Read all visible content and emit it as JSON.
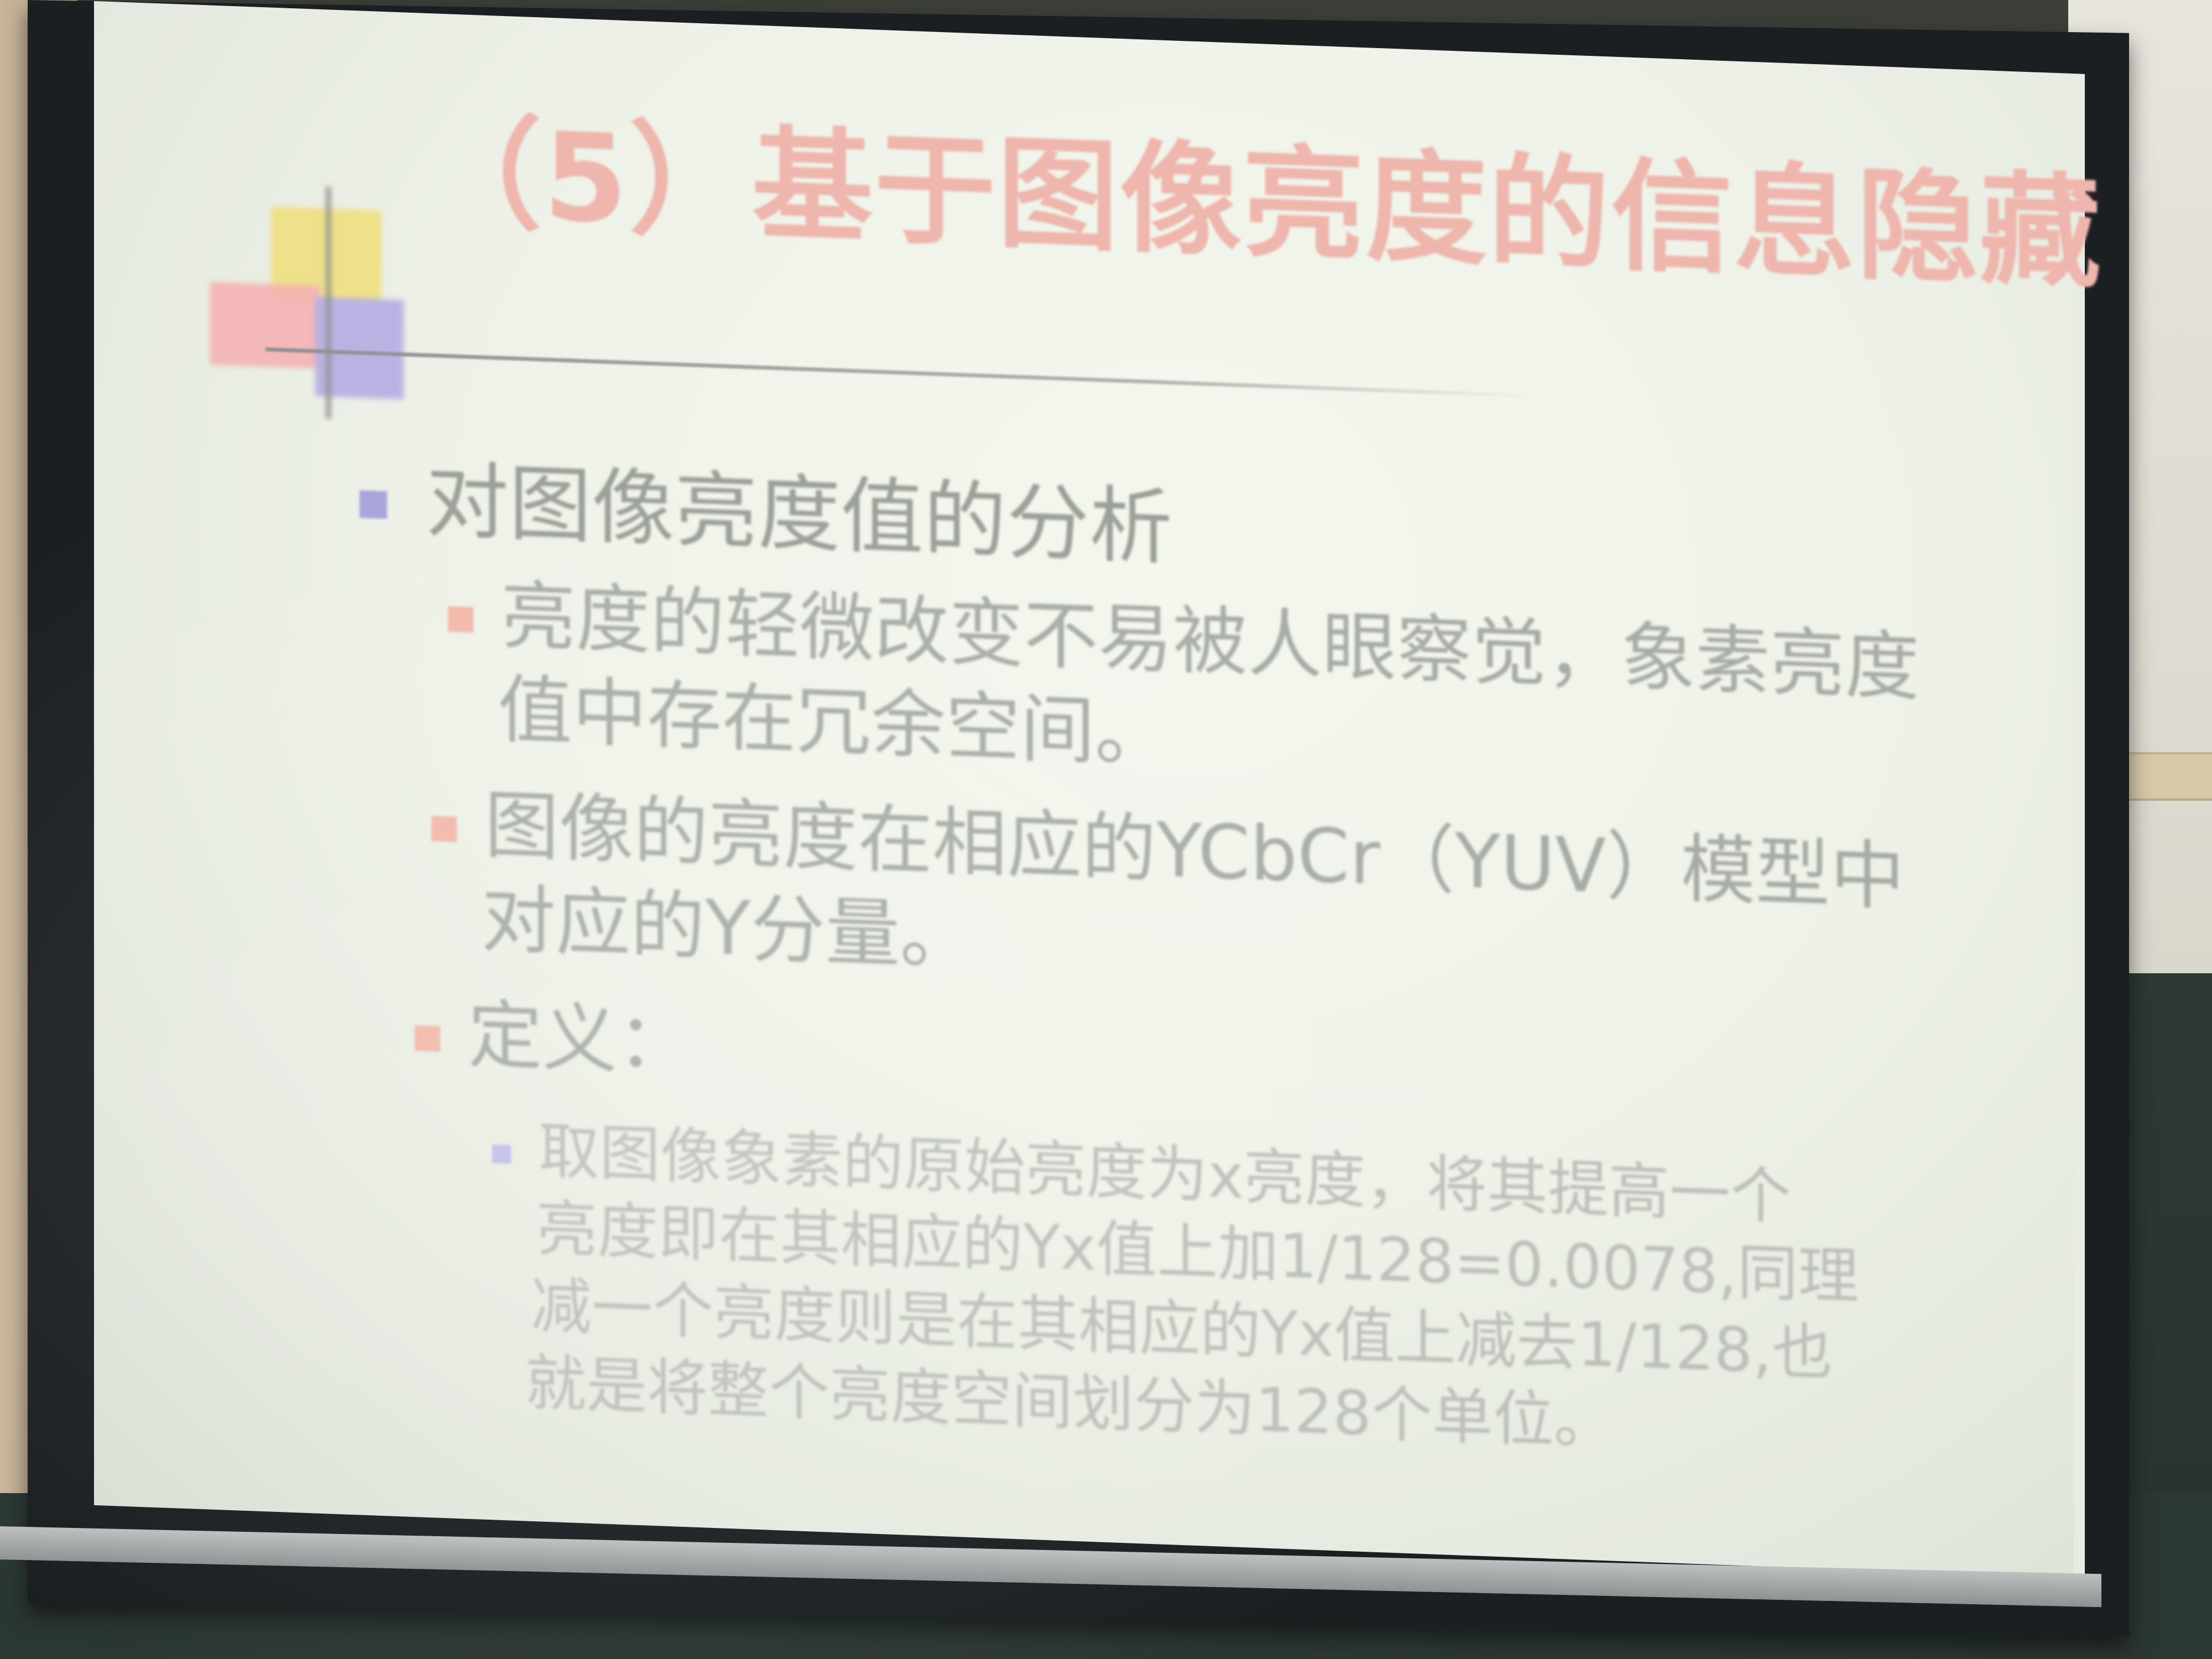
{
  "slide": {
    "title": "（5）基于图像亮度的信息隐藏",
    "heading": "对图像亮度值的分析",
    "points": [
      {
        "line1": "亮度的轻微改变不易被人眼察觉，象素亮度",
        "line2": "值中存在冗余空间。"
      },
      {
        "line1": "图像的亮度在相应的YCbCr（YUV）模型中",
        "line2": "对应的Y分量。"
      },
      {
        "line1": "定义："
      }
    ],
    "definition": {
      "line1": "取图像象素的原始亮度为x亮度，将其提高一个",
      "line2": "亮度即在其相应的Yx值上加1/128=0.0078,同理",
      "line3": "减一个亮度则是在其相应的Yx值上减去1/128,也",
      "line4": "就是将整个亮度空间划分为128个单位。"
    }
  },
  "colors": {
    "title": "#eeb6ad",
    "deco_yellow": "#efe08a",
    "deco_red": "#f4b3b3",
    "deco_purple": "#b6b0e4",
    "screen": "#eef2e8",
    "chalkboard": "#2b3732"
  }
}
